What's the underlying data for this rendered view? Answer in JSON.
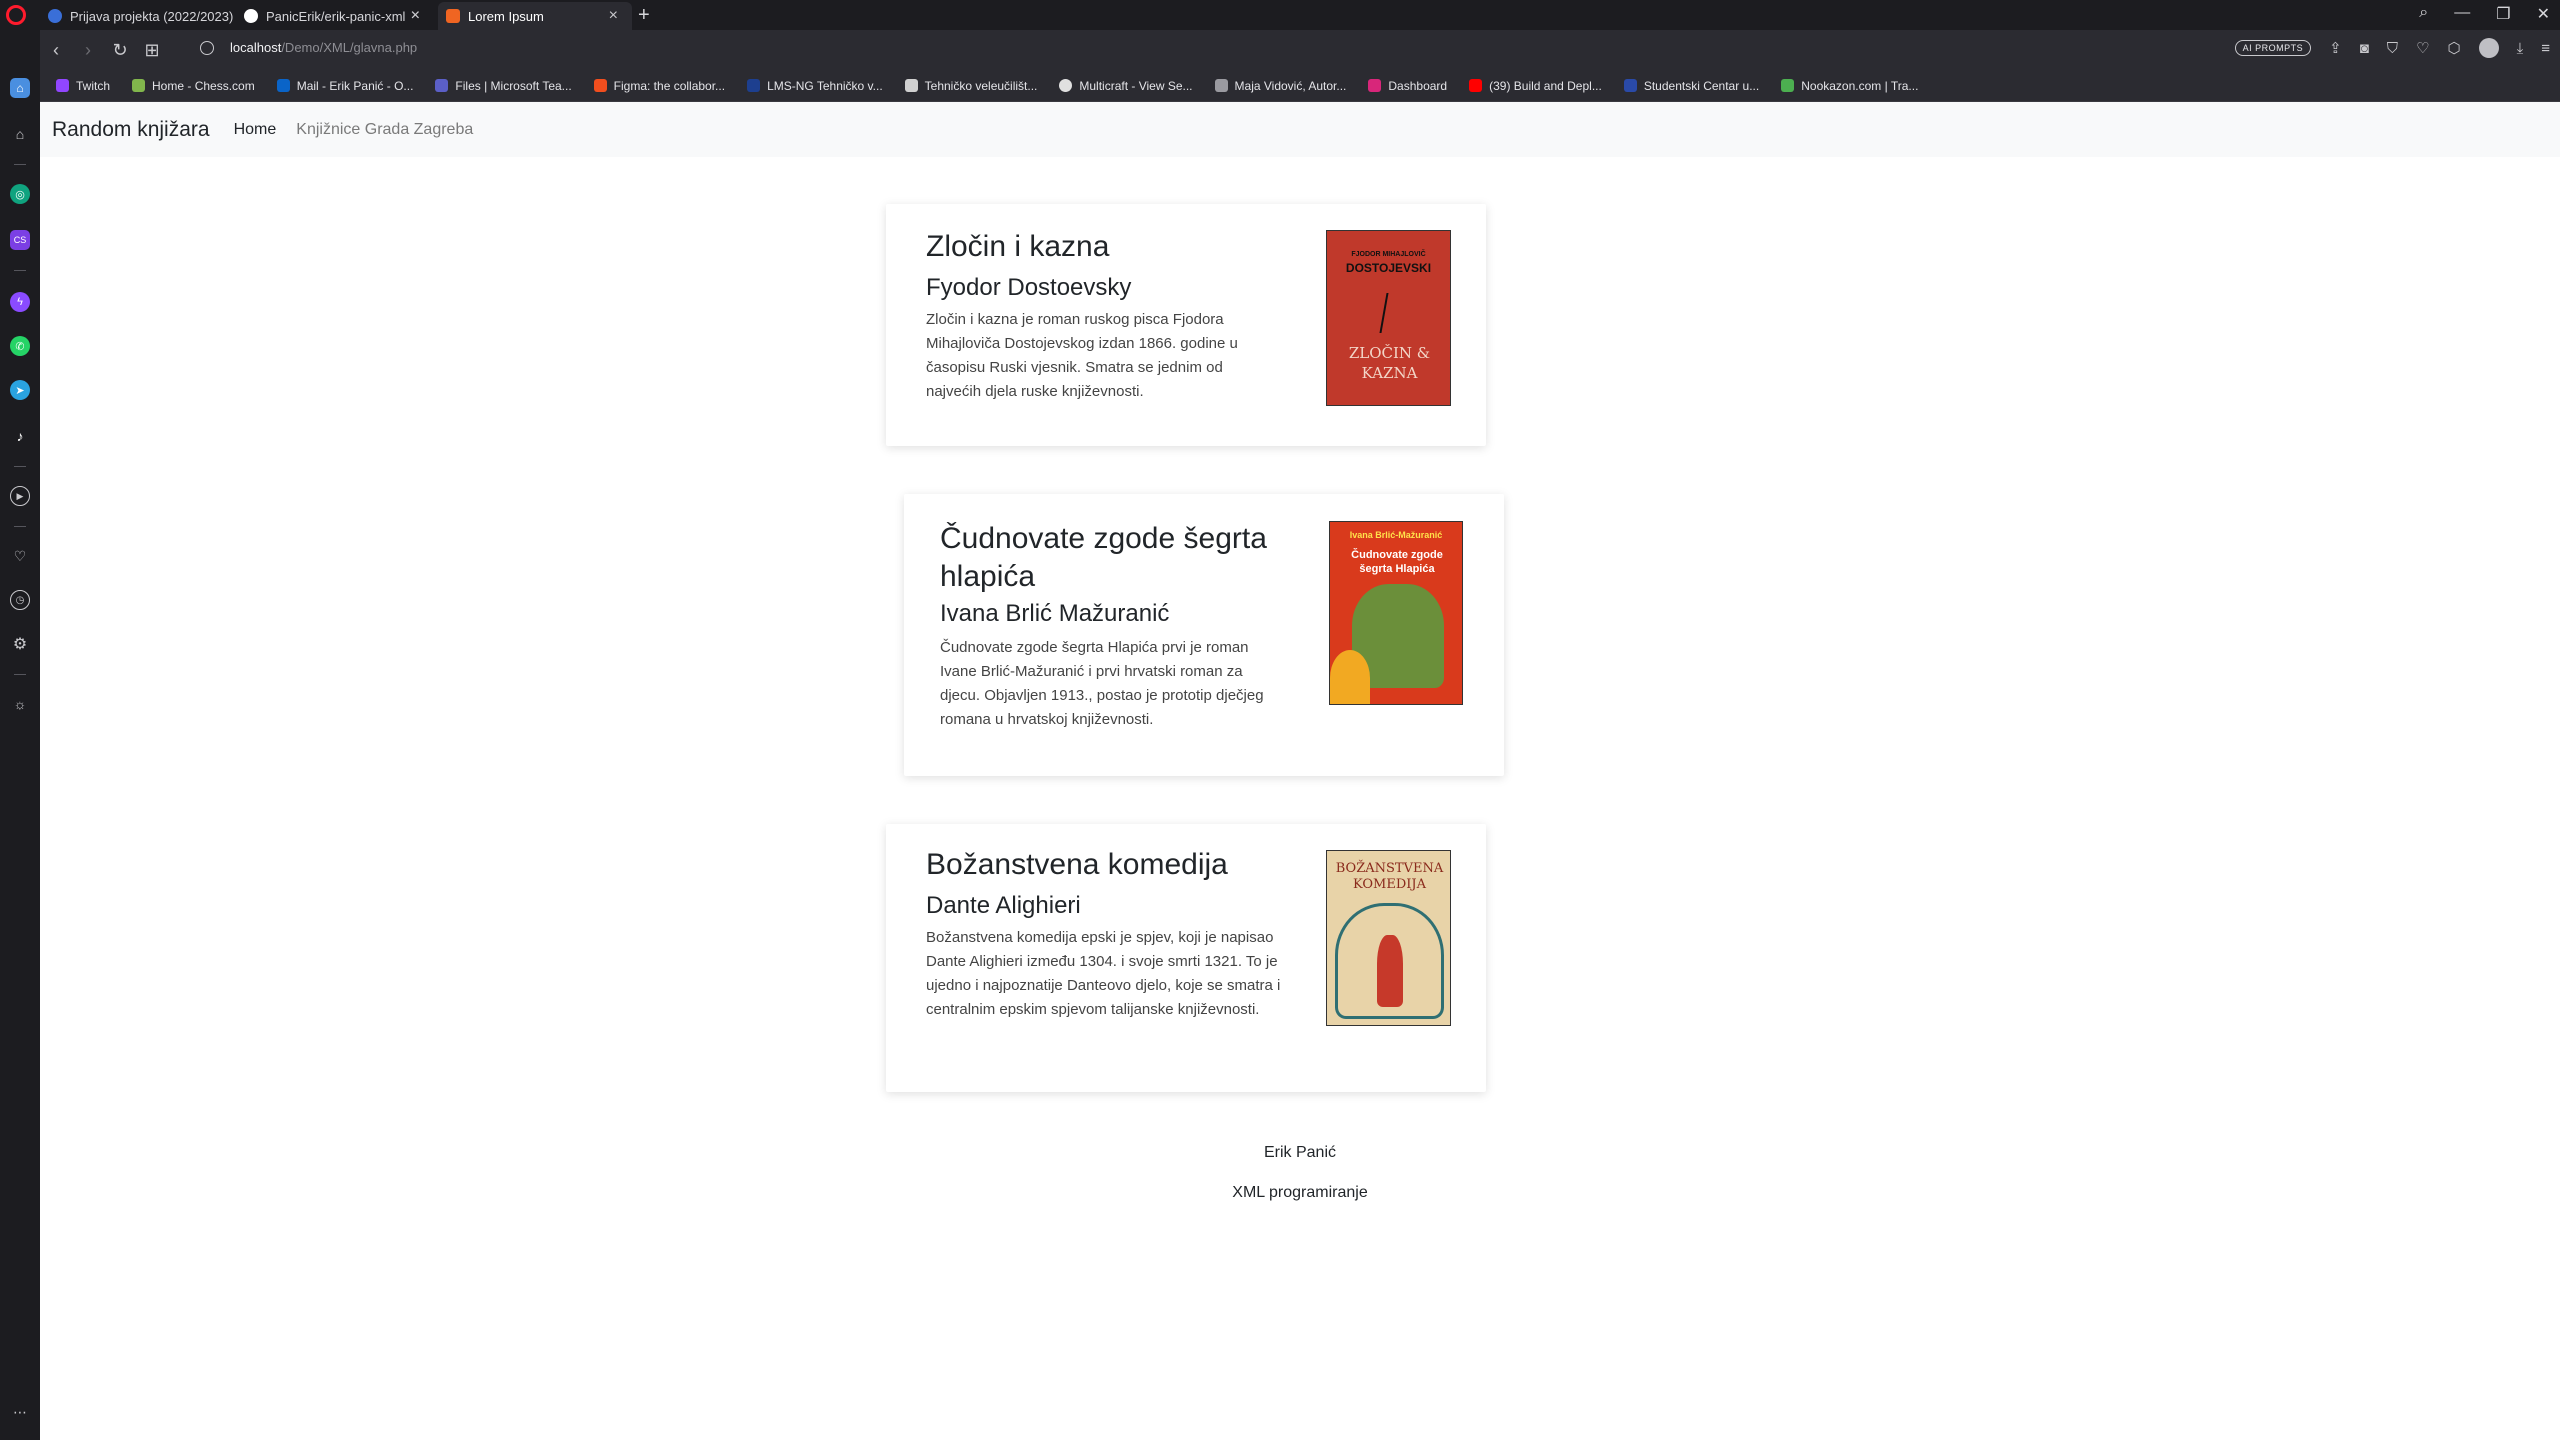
{
  "browser": {
    "tabs": [
      {
        "title": "Prijava projekta (2022/2023)",
        "color": "#3a6fd8"
      },
      {
        "title": "PanicErik/erik-panic-xml",
        "color": "#ffffff"
      },
      {
        "title": "Lorem Ipsum",
        "color": "#f06522"
      }
    ],
    "url_host": "localhost",
    "url_path": "/Demo/XML/glavna.php",
    "ai_prompts_label": "AI PROMPTS",
    "bookmarks": [
      {
        "label": "Twitch",
        "color": "#9146ff"
      },
      {
        "label": "Home - Chess.com",
        "color": "#81b64c"
      },
      {
        "label": "Mail - Erik Panić - O...",
        "color": "#0a64c8"
      },
      {
        "label": "Files | Microsoft Tea...",
        "color": "#5b5fc7"
      },
      {
        "label": "Figma: the collabor...",
        "color": "#f24e1e"
      },
      {
        "label": "LMS-NG Tehničko v...",
        "color": "#1d3f8f"
      },
      {
        "label": "Tehničko veleučilišt...",
        "color": "#d0d0d0"
      },
      {
        "label": "Multicraft - View Se...",
        "color": "#e0e0e0"
      },
      {
        "label": "Maja Vidović, Autor...",
        "color": "#9a9aa0"
      },
      {
        "label": "Dashboard",
        "color": "#d8267a"
      },
      {
        "label": "(39) Build and Depl...",
        "color": "#ff0000"
      },
      {
        "label": "Studentski Centar u...",
        "color": "#2a4aa8"
      },
      {
        "label": "Nookazon.com | Tra...",
        "color": "#4caf50"
      }
    ],
    "sidebar_icons": [
      "home-icon",
      "chatgpt-icon",
      "cs-extension-icon",
      "messenger-icon",
      "whatsapp-icon",
      "telegram-icon",
      "tiktok-icon",
      "player-icon",
      "heart-icon",
      "history-icon",
      "settings-icon",
      "lightbulb-icon",
      "more-icon"
    ]
  },
  "site": {
    "brand": "Random knjižara",
    "nav": [
      "Home",
      "Knjižnice Grada Zagreba"
    ]
  },
  "books": [
    {
      "title": "Zločin i kazna",
      "author": "Fyodor Dostoevsky",
      "description": "Zločin i kazna je roman ruskog pisca Fjodora Mihajloviča Dostojevskog izdan 1866. godine u časopisu Ruski vjesnik. Smatra se jednim od najvećih djela ruske književnosti.",
      "cover": {
        "top_text": "FJODOR MIHAJLOVIČ",
        "author_text": "DOSTOJEVSKI",
        "title_text": "ZLOČIN & KAZNA",
        "color": "#c0392b"
      }
    },
    {
      "title": "Čudnovate zgode šegrta hlapića",
      "author": "Ivana Brlić Mažuranić",
      "description": "Čudnovate zgode šegrta Hlapića prvi je roman Ivane Brlić-Mažuranić i prvi hrvatski roman za djecu. Objavljen 1913., postao je prototip dječjeg romana u hrvatskoj književnosti.",
      "cover": {
        "top_text": "Ivana Brlić-Mažuranić",
        "title_text": "Čudnovate zgode šegrta Hlapića",
        "color": "#d93a1c"
      }
    },
    {
      "title": "Božanstvena komedija",
      "author": "Dante Alighieri",
      "description": "Božanstvena komedija epski je spjev, koji je napisao Dante Alighieri između 1304. i svoje smrti 1321. To je ujedno i najpoznatije Danteovo djelo, koje se smatra i centralnim epskim spjevom talijanske književnosti.",
      "cover": {
        "title_text": "BOŽANSTVENA KOMEDIJA",
        "color": "#e8d3a8"
      }
    }
  ],
  "footer": {
    "name": "Erik Panić",
    "course": "XML programiranje"
  }
}
